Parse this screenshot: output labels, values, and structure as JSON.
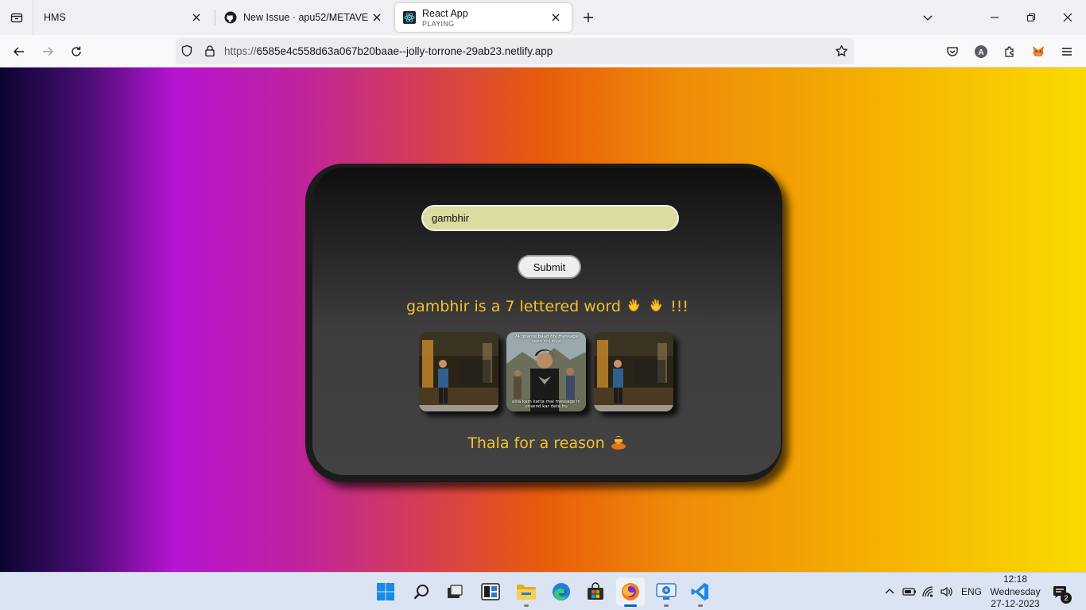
{
  "browser": {
    "tabs": [
      {
        "title": "HMS",
        "subtitle": ""
      },
      {
        "title": "New Issue · apu52/METAVERSE",
        "subtitle": ""
      },
      {
        "title": "React App",
        "subtitle": "PLAYING"
      }
    ],
    "active_tab_index": 2,
    "url_host": "6585e4c558d63a067b20baae--jolly-torrone-29ab23.netlify.app",
    "url_scheme": "https://"
  },
  "app": {
    "input_value": "gambhir",
    "submit_label": "Submit",
    "result_text": "gambhir is a 7 lettered word",
    "result_suffix": "!!!",
    "tagline": "Thala for a reason",
    "meme_top_caption": "24 ghante baad bhi message seen nhi kiya",
    "meme_bottom_caption": "aisa kam karta mai message hi unsend kar deta hu"
  },
  "taskbar": {
    "pinned": [
      "windows-start",
      "search",
      "task-view",
      "widgets",
      "file-explorer",
      "edge",
      "store",
      "firefox",
      "remote-desktop",
      "vscode"
    ],
    "language": "ENG",
    "time": "12:18",
    "day": "Wednesday",
    "date": "27-12-2023",
    "notification_count": "2"
  },
  "colors": {
    "accent_text": "#f3c12c",
    "input_bg": "#dcdba0",
    "card_bg": "#3d3d3d"
  }
}
